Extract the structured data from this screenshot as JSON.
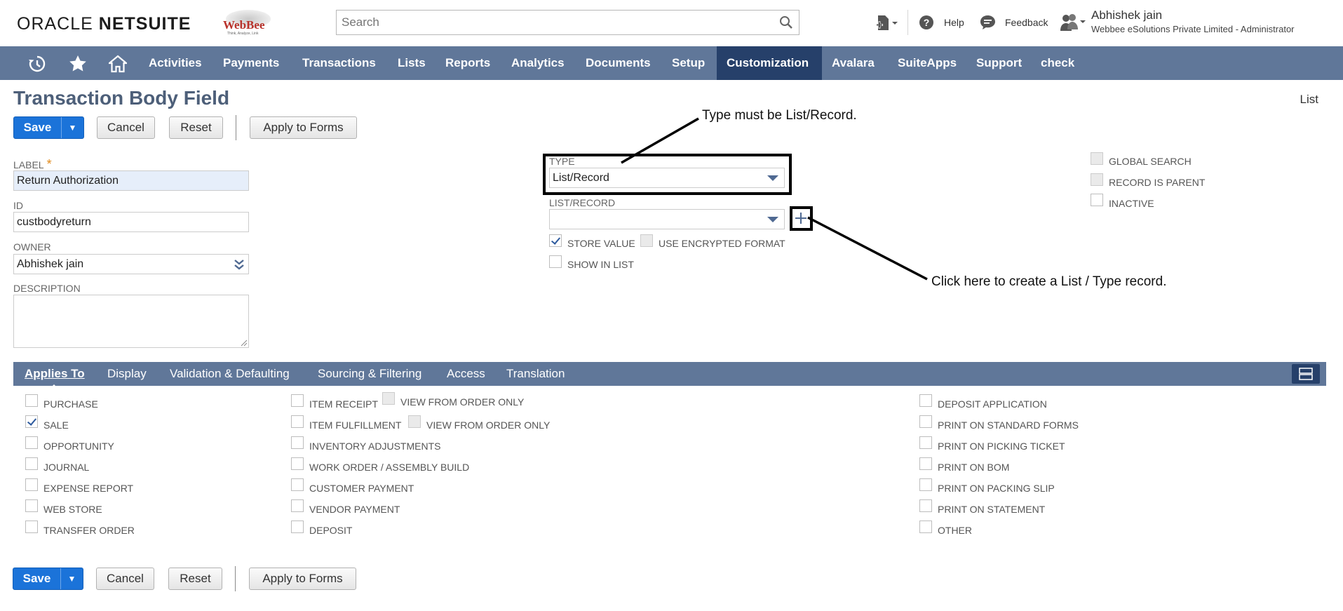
{
  "header": {
    "brand_oracle": "ORACLE",
    "brand_netsuite": "NETSUITE",
    "company_logo_text": "WebBee",
    "company_logo_tagline": "Think, Analyze, Link",
    "search_placeholder": "Search",
    "help_label": "Help",
    "feedback_label": "Feedback",
    "user_name": "Abhishek jain",
    "user_role": "Webbee eSolutions Private Limited - Administrator"
  },
  "nav": {
    "items": [
      "Activities",
      "Payments",
      "Transactions",
      "Lists",
      "Reports",
      "Analytics",
      "Documents",
      "Setup",
      "Customization",
      "Avalara",
      "SuiteApps",
      "Support",
      "check"
    ],
    "active": "Customization"
  },
  "page": {
    "title": "Transaction Body Field",
    "record_link": "List"
  },
  "buttons": {
    "save": "Save",
    "cancel": "Cancel",
    "reset": "Reset",
    "apply_to_forms": "Apply to Forms"
  },
  "fields": {
    "label_label": "LABEL",
    "label_required": "*",
    "label_value": "Return Authorization",
    "id_label": "ID",
    "id_value": "custbodyreturn",
    "owner_label": "OWNER",
    "owner_value": "Abhishek  jain",
    "description_label": "DESCRIPTION",
    "type_label": "TYPE",
    "type_value": "List/Record",
    "list_record_label": "LIST/RECORD",
    "list_record_value": ""
  },
  "options": {
    "store_value": {
      "label": "STORE VALUE",
      "checked": true
    },
    "use_encrypted_format": {
      "label": "USE ENCRYPTED FORMAT",
      "checked": false
    },
    "show_in_list": {
      "label": "SHOW IN LIST",
      "checked": false
    },
    "global_search": {
      "label": "GLOBAL SEARCH",
      "checked": false
    },
    "record_is_parent": {
      "label": "RECORD IS PARENT",
      "checked": false
    },
    "inactive": {
      "label": "INACTIVE",
      "checked": false
    }
  },
  "annotations": {
    "type_note": "Type must be List/Record.",
    "plus_note": "Click here to create a List / Type record."
  },
  "subtabs": {
    "applies_to": "Applies To",
    "display": "Display",
    "validation": "Validation & Defaulting",
    "sourcing": "Sourcing & Filtering",
    "access": "Access",
    "translation": "Translation"
  },
  "applies_to": {
    "col1": [
      {
        "label": "PURCHASE",
        "checked": false
      },
      {
        "label": "SALE",
        "checked": true
      },
      {
        "label": "OPPORTUNITY",
        "checked": false
      },
      {
        "label": "JOURNAL",
        "checked": false
      },
      {
        "label": "EXPENSE REPORT",
        "checked": false
      },
      {
        "label": "WEB STORE",
        "checked": false
      },
      {
        "label": "TRANSFER ORDER",
        "checked": false
      }
    ],
    "col2": [
      {
        "label": "ITEM RECEIPT",
        "checked": false
      },
      {
        "label": "ITEM FULFILLMENT",
        "checked": false
      },
      {
        "label": "INVENTORY ADJUSTMENTS",
        "checked": false
      },
      {
        "label": "WORK ORDER / ASSEMBLY BUILD",
        "checked": false
      },
      {
        "label": "CUSTOMER PAYMENT",
        "checked": false
      },
      {
        "label": "VENDOR PAYMENT",
        "checked": false
      },
      {
        "label": "DEPOSIT",
        "checked": false
      }
    ],
    "view_from_order_only": "VIEW FROM ORDER ONLY",
    "col3": [
      {
        "label": "DEPOSIT APPLICATION",
        "checked": false
      },
      {
        "label": "PRINT ON STANDARD FORMS",
        "checked": false
      },
      {
        "label": "PRINT ON PICKING TICKET",
        "checked": false
      },
      {
        "label": "PRINT ON BOM",
        "checked": false
      },
      {
        "label": "PRINT ON PACKING SLIP",
        "checked": false
      },
      {
        "label": "PRINT ON STATEMENT",
        "checked": false
      },
      {
        "label": "OTHER",
        "checked": false
      }
    ]
  },
  "colors": {
    "nav_bg": "#607799",
    "nav_active": "#26406a",
    "save_button": "#1b73d9",
    "title": "#4d5f79"
  }
}
